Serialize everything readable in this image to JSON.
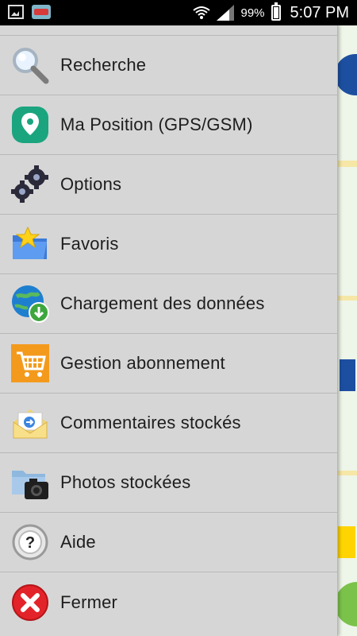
{
  "status_bar": {
    "battery_percent": "99%",
    "time": "5:07 PM",
    "icons": [
      "gallery-icon",
      "app-notification-icon",
      "wifi-icon",
      "signal-icon",
      "battery-icon"
    ]
  },
  "menu": {
    "items": [
      {
        "label": "Recherche",
        "icon": "search-icon"
      },
      {
        "label": "Ma Position (GPS/GSM)",
        "icon": "location-icon"
      },
      {
        "label": "Options",
        "icon": "gears-icon"
      },
      {
        "label": "Favoris",
        "icon": "favorites-folder-icon"
      },
      {
        "label": "Chargement des données",
        "icon": "globe-download-icon"
      },
      {
        "label": "Gestion abonnement",
        "icon": "cart-icon"
      },
      {
        "label": "Commentaires stockés",
        "icon": "mail-icon"
      },
      {
        "label": "Photos stockées",
        "icon": "camera-folder-icon"
      },
      {
        "label": "Aide",
        "icon": "help-icon"
      },
      {
        "label": "Fermer",
        "icon": "close-icon"
      }
    ]
  },
  "colors": {
    "drawer_bg": "#d6d6d6",
    "status_bar_bg": "#000000",
    "close_red": "#e3232a",
    "location_teal": "#1aa57f",
    "cart_orange": "#f39a1d"
  }
}
